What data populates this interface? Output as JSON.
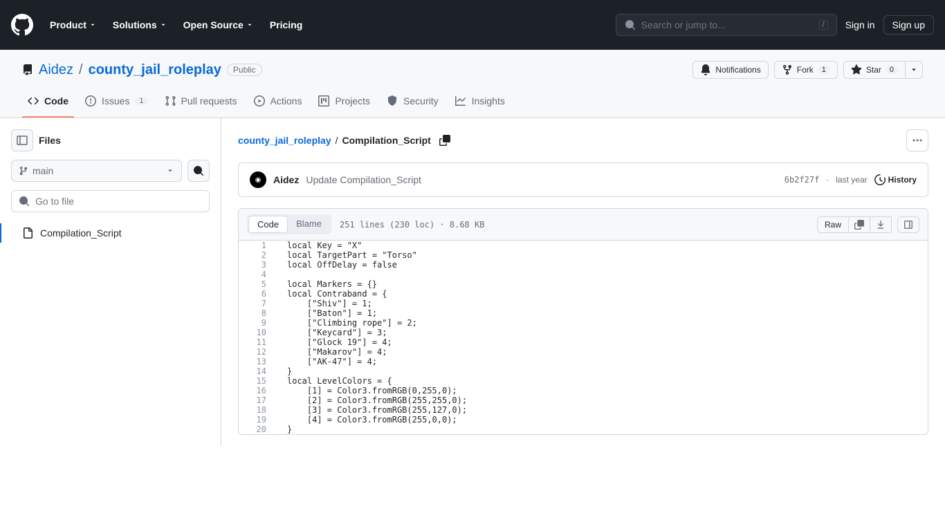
{
  "header": {
    "nav": [
      "Product",
      "Solutions",
      "Open Source",
      "Pricing"
    ],
    "search_placeholder": "Search or jump to...",
    "signin": "Sign in",
    "signup": "Sign up"
  },
  "repo": {
    "owner": "Aidez",
    "name": "county_jail_roleplay",
    "visibility": "Public",
    "actions": {
      "notifications": "Notifications",
      "fork": "Fork",
      "fork_count": "1",
      "star": "Star",
      "star_count": "0"
    }
  },
  "tabs": {
    "code": "Code",
    "issues": "Issues",
    "issues_count": "1",
    "pulls": "Pull requests",
    "actions": "Actions",
    "projects": "Projects",
    "security": "Security",
    "insights": "Insights"
  },
  "sidebar": {
    "files": "Files",
    "branch": "main",
    "filter_placeholder": "Go to file",
    "file": "Compilation_Script"
  },
  "breadcrumb": {
    "root": "county_jail_roleplay",
    "current": "Compilation_Script"
  },
  "commit": {
    "author": "Aidez",
    "message": "Update Compilation_Script",
    "hash": "6b2f27f",
    "date": "last year",
    "history": "History"
  },
  "codehead": {
    "code_tab": "Code",
    "blame_tab": "Blame",
    "info": "251 lines (230 loc) · 8.68 KB",
    "raw": "Raw"
  },
  "code_lines": [
    "local Key = \"X\"",
    "local TargetPart = \"Torso\"",
    "local OffDelay = false",
    "",
    "local Markers = {}",
    "local Contraband = {",
    "    [\"Shiv\"] = 1;",
    "    [\"Baton\"] = 1;",
    "    [\"Climbing rope\"] = 2;",
    "    [\"Keycard\"] = 3;",
    "    [\"Glock 19\"] = 4;",
    "    [\"Makarov\"] = 4;",
    "    [\"AK-47\"] = 4;",
    "}",
    "local LevelColors = {",
    "    [1] = Color3.fromRGB(0,255,0);",
    "    [2] = Color3.fromRGB(255,255,0);",
    "    [3] = Color3.fromRGB(255,127,0);",
    "    [4] = Color3.fromRGB(255,0,0);",
    "}"
  ]
}
